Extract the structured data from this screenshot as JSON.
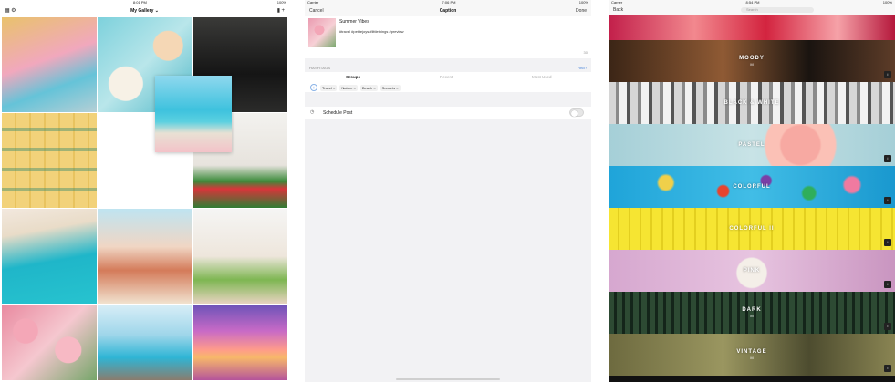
{
  "screen1": {
    "status": {
      "carrier": "",
      "time": "8:01 PM",
      "battery": "100%"
    },
    "nav": {
      "title": "My Gallery ⌄",
      "left_icons": [
        "calendar-icon",
        "gear-icon"
      ],
      "right_icons": [
        "bar-chart-icon",
        "plus-icon"
      ]
    }
  },
  "screen2": {
    "status": {
      "carrier": "Carrier",
      "time": "7:06 PM",
      "battery": "100%"
    },
    "nav": {
      "cancel": "Cancel",
      "title": "Caption",
      "done": "Done"
    },
    "caption": {
      "text": "Summer Vibes",
      "hashtags": "#travel #petitejoys #littlethings #preview",
      "count": "30"
    },
    "hashtags_section": {
      "label": "HASHTAGS",
      "find": "Find ›"
    },
    "tabs": [
      "Groups",
      "Recent",
      "Most Used"
    ],
    "chips": [
      "Travel ×",
      "Nature ×",
      "Beach ×",
      "Sunsets ×"
    ],
    "schedule": {
      "label": "Schedule Post"
    }
  },
  "screen3": {
    "status": {
      "carrier": "Carrier",
      "time": "8:54 PM",
      "battery": "100%"
    },
    "nav": {
      "back": "Back",
      "search_placeholder": "Search"
    },
    "filters": [
      {
        "name": "",
        "sub": "",
        "badge": "",
        "cls": "b-fruit"
      },
      {
        "name": "MOODY",
        "sub": "M",
        "badge": "i",
        "cls": "b-moody"
      },
      {
        "name": "BLACK & WHITE",
        "sub": "",
        "badge": "",
        "cls": "b-bw"
      },
      {
        "name": "PASTEL",
        "sub": "",
        "badge": "i",
        "cls": "b-pastel"
      },
      {
        "name": "COLORFUL",
        "sub": "",
        "badge": "i",
        "cls": "b-colorful"
      },
      {
        "name": "COLORFUL II",
        "sub": "",
        "badge": "i",
        "cls": "b-col2"
      },
      {
        "name": "PINK",
        "sub": "",
        "badge": "i",
        "cls": "b-pink"
      },
      {
        "name": "DARK",
        "sub": "M",
        "badge": "i",
        "cls": "b-dark"
      },
      {
        "name": "VINTAGE",
        "sub": "M",
        "badge": "i",
        "cls": "b-vintage"
      }
    ]
  }
}
